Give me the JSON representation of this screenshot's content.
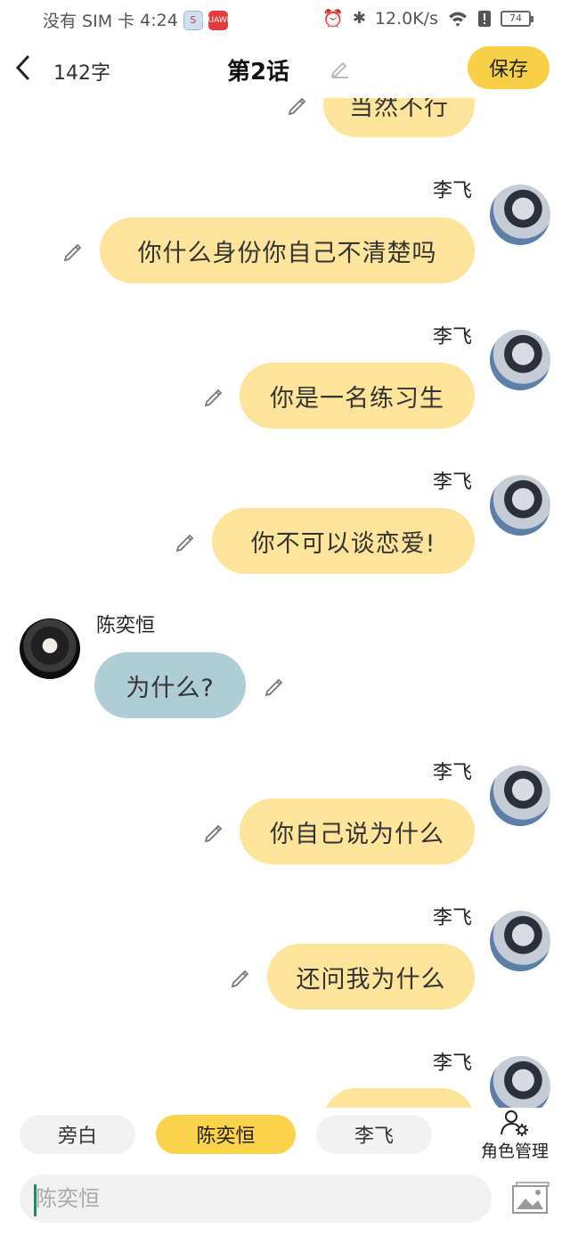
{
  "status_bar": {
    "carrier": "没有 SIM 卡",
    "time": "4:24",
    "app1_label": "S",
    "app2_label": "HUAWEI",
    "speed": "12.0K/s",
    "battery": "74"
  },
  "header": {
    "word_count": "142字",
    "title": "第2话",
    "save_label": "保存"
  },
  "messages": [
    {
      "speaker": "",
      "text": "当然不行"
    },
    {
      "speaker": "李飞",
      "text": "你什么身份你自己不清楚吗"
    },
    {
      "speaker": "李飞",
      "text": "你是一名练习生"
    },
    {
      "speaker": "李飞",
      "text": "你不可以谈恋爱!"
    },
    {
      "speaker": "陈奕恒",
      "text": "为什么?"
    },
    {
      "speaker": "李飞",
      "text": "你自己说为什么"
    },
    {
      "speaker": "李飞",
      "text": "还问我为什么"
    },
    {
      "speaker": "李飞",
      "text": ""
    }
  ],
  "roles": {
    "narration": "旁白",
    "role1": "陈奕恒",
    "role2": "李飞",
    "manage_label": "角色管理"
  },
  "input": {
    "placeholder": "陈奕恒"
  },
  "colors": {
    "accent": "#f7d047",
    "bubble_right": "#fde49a",
    "bubble_left": "#afcdd4"
  }
}
